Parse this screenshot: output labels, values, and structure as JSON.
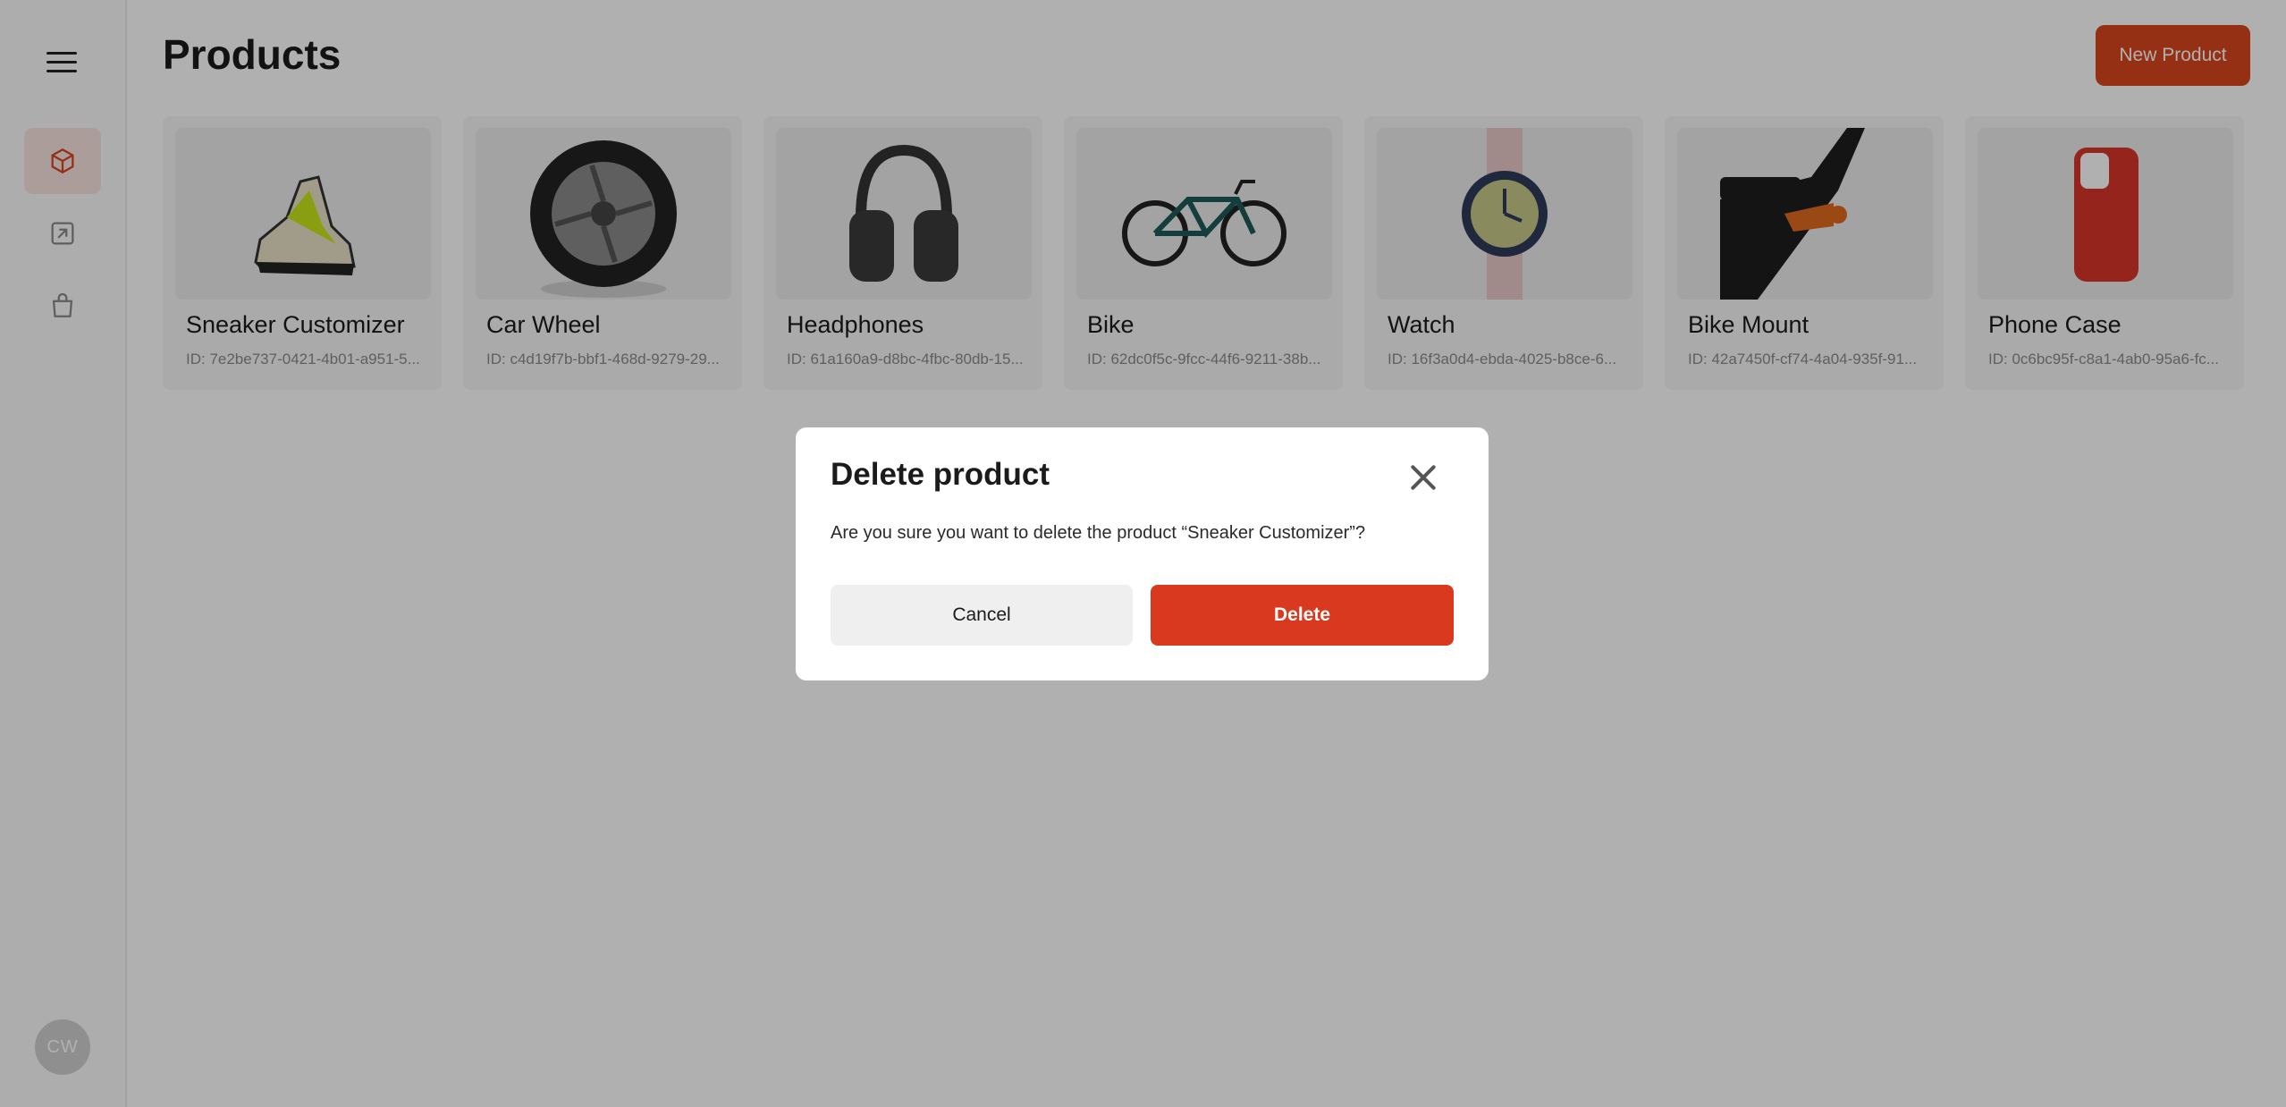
{
  "page": {
    "title": "Products",
    "new_button_label": "New Product"
  },
  "sidebar": {
    "menu_icon": "hamburger-menu-icon",
    "items": [
      {
        "icon": "cube-icon",
        "active": true
      },
      {
        "icon": "external-link-icon",
        "active": false
      },
      {
        "icon": "shopping-bag-icon",
        "active": false
      }
    ],
    "avatar_initials": "CW"
  },
  "products": [
    {
      "name": "Sneaker Customizer",
      "id": "ID: 7e2be737-0421-4b01-a951-5..."
    },
    {
      "name": "Car Wheel",
      "id": "ID: c4d19f7b-bbf1-468d-9279-29..."
    },
    {
      "name": "Headphones",
      "id": "ID: 61a160a9-d8bc-4fbc-80db-15..."
    },
    {
      "name": "Bike",
      "id": "ID: 62dc0f5c-9fcc-44f6-9211-38b..."
    },
    {
      "name": "Watch",
      "id": "ID: 16f3a0d4-ebda-4025-b8ce-6..."
    },
    {
      "name": "Bike Mount",
      "id": "ID: 42a7450f-cf74-4a04-935f-91..."
    },
    {
      "name": "Phone Case",
      "id": "ID: 0c6bc95f-c8a1-4ab0-95a6-fc..."
    }
  ],
  "modal": {
    "title": "Delete product",
    "message": "Are you sure you want to delete the product “Sneaker Customizer”?",
    "cancel_label": "Cancel",
    "delete_label": "Delete",
    "close_icon": "close-icon"
  },
  "colors": {
    "accent": "#d9461f",
    "delete": "#d9391f",
    "overlay": "rgba(0,0,0,0.31)"
  }
}
